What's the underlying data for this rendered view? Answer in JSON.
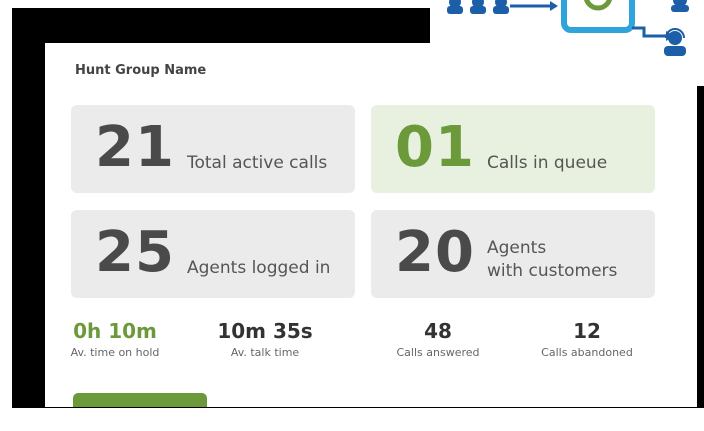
{
  "dashboard": {
    "title": "Hunt Group Name",
    "cards": [
      {
        "value": "21",
        "label": "Total active calls",
        "highlight": false
      },
      {
        "value": "01",
        "label": "Calls in queue",
        "highlight": true
      },
      {
        "value": "25",
        "label": "Agents logged in",
        "highlight": false
      },
      {
        "value": "20",
        "label_line1": "Agents",
        "label_line2": "with customers",
        "highlight": false
      }
    ],
    "stats": [
      {
        "value": "0h 10m",
        "label": "Av. time on hold",
        "highlight": true
      },
      {
        "value": "10m 35s",
        "label": "Av. talk time",
        "highlight": false
      },
      {
        "value": "48",
        "label": "Calls answered",
        "highlight": false
      },
      {
        "value": "12",
        "label": "Calls abandoned",
        "highlight": false
      }
    ]
  },
  "diagram": {
    "icons": [
      "group-people-icon",
      "hub-icon",
      "agent-icon",
      "agent-headset-icon"
    ]
  },
  "colors": {
    "accent_green": "#6c9a3a",
    "card_bg": "#ebebeb",
    "card_green_bg": "#e8f1df",
    "diagram_blue": "#1c5fa8",
    "hub_blue": "#2fa3dc"
  }
}
